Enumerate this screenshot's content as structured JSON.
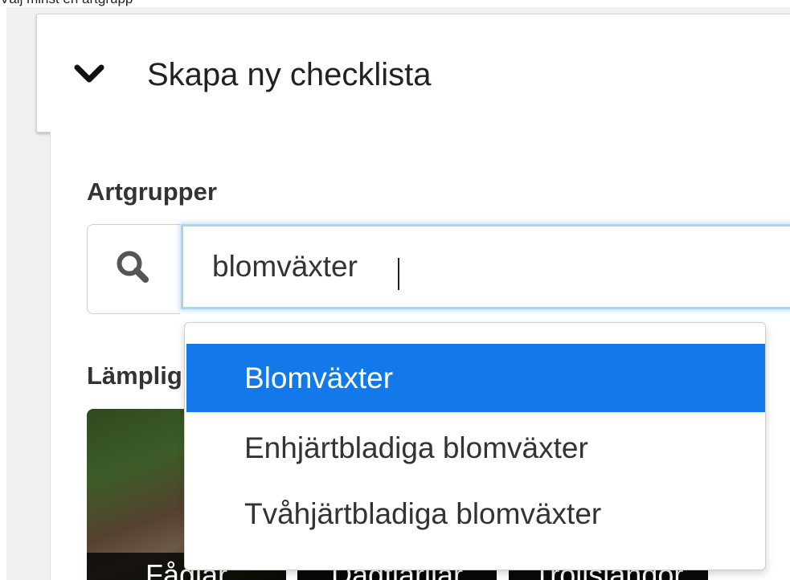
{
  "top_cut_text": "Välj minst en artgrupp",
  "card": {
    "title": "Skapa ny checklista",
    "toggle_icon": "chevron-down-icon"
  },
  "artgrupper": {
    "label": "Artgrupper",
    "search_icon": "search-icon",
    "input_value": "blomväxter"
  },
  "suggestions": [
    {
      "label": "Blomväxter",
      "active": true
    },
    {
      "label": "Enhjärtbladiga blomväxter",
      "active": false
    },
    {
      "label": "Tvåhjärtbladiga blomväxter",
      "active": false
    }
  ],
  "lamplig_label": "Lämplig",
  "tiles": [
    {
      "label": "Fåglar"
    },
    {
      "label": "Dagfjärilar"
    },
    {
      "label": "Trollsländor"
    }
  ],
  "colors": {
    "accent": "#1379ea",
    "focus_border": "#a9d6ee"
  }
}
